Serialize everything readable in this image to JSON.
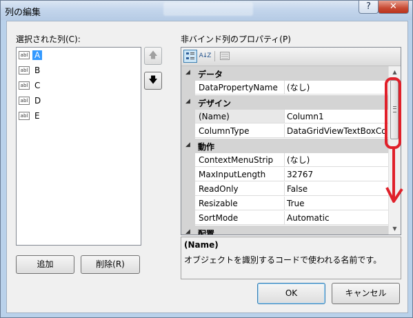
{
  "window": {
    "title": "列の編集",
    "help_glyph": "?",
    "close_glyph": "✕"
  },
  "left_panel": {
    "label": "選択された列(C):",
    "columns": [
      "A",
      "B",
      "C",
      "D",
      "E"
    ],
    "column_icon_text": "abl",
    "selected_index": 0,
    "move_up_glyph": "🡅",
    "move_down_glyph": "🡇",
    "add_label": "追加",
    "remove_label": "削除(R)"
  },
  "right_panel": {
    "label": "非バインド列のプロパティ(P)",
    "toolbar": {
      "categorized_icon": "categorized-icon",
      "alphabetical_icon": "alphabetical-sort-icon",
      "alphabetical_glyph": "A↓Z",
      "property_pages_icon": "property-pages-icon"
    },
    "categories": [
      {
        "name": "データ",
        "props": [
          {
            "name": "DataPropertyName",
            "value": "(なし)"
          }
        ]
      },
      {
        "name": "デザイン",
        "props": [
          {
            "name": "(Name)",
            "value": "Column1"
          },
          {
            "name": "ColumnType",
            "value": "DataGridViewTextBoxCo"
          }
        ]
      },
      {
        "name": "動作",
        "props": [
          {
            "name": "ContextMenuStrip",
            "value": "(なし)"
          },
          {
            "name": "MaxInputLength",
            "value": "32767"
          },
          {
            "name": "ReadOnly",
            "value": "False"
          },
          {
            "name": "Resizable",
            "value": "True"
          },
          {
            "name": "SortMode",
            "value": "Automatic"
          }
        ]
      },
      {
        "name": "配置",
        "props": []
      }
    ],
    "collapse_glyph": "◢",
    "scroll_up_glyph": "▲",
    "scroll_down_glyph": "▼",
    "description": {
      "title": "(Name)",
      "text": "オブジェクトを識別するコードで使われる名前です。"
    }
  },
  "footer": {
    "ok_label": "OK",
    "cancel_label": "キャンセル"
  },
  "annotation": {
    "color": "#e0202a"
  }
}
